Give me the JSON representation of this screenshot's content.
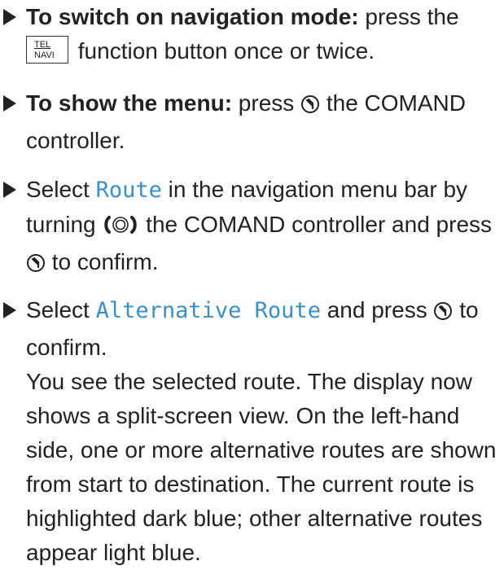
{
  "steps": [
    {
      "bold": "To switch on navigation mode:",
      "text1": " press the",
      "key_top": "TEL",
      "key_bottom": "NAVI",
      "text2": " function button once or twice."
    },
    {
      "bold": "To show the menu:",
      "text1": " press",
      "text2": " the COMAND controller."
    },
    {
      "text1": "Select ",
      "display1": "Route",
      "text2": " in the navigation menu bar by turning",
      "text3": " the COMAND controller and press",
      "text4": " to confirm."
    },
    {
      "text1": "Select ",
      "display1": "Alternative Route",
      "text2": " and press",
      "text3": " to confirm.",
      "paragraph": "You see the selected route. The display now shows a split-screen view. On the left-hand side, one or more alternative routes are shown from start to destination. The current route is highlighted dark blue; other alternative routes appear light blue."
    }
  ],
  "icons": {
    "press": "press-controller-icon",
    "turn": "turn-controller-icon"
  },
  "colors": {
    "text": "#222222",
    "display_text": "#3a8fc4"
  }
}
